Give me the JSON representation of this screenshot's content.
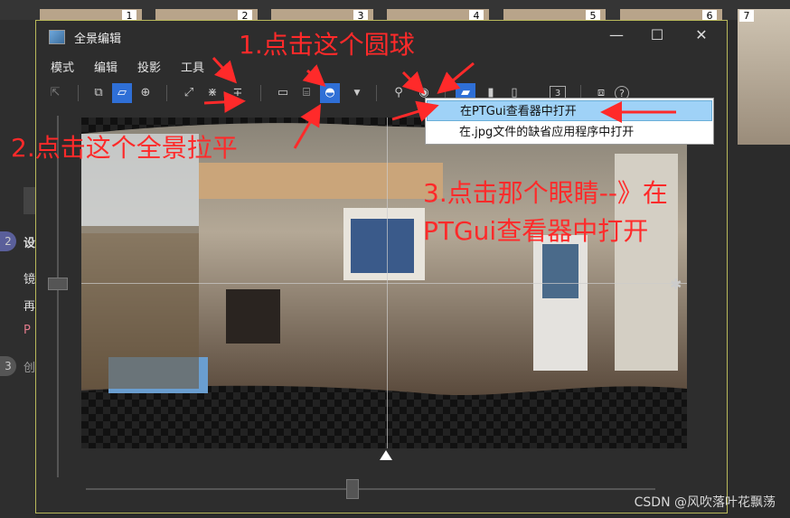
{
  "thumbnails": [
    "1",
    "2",
    "3",
    "4",
    "5",
    "6",
    "7"
  ],
  "sidebar": {
    "step2_num": "2",
    "step2_title": "设",
    "lines": [
      "镜",
      "再",
      "P"
    ],
    "step3_num": "3",
    "step3_title": "创"
  },
  "window": {
    "title": "全景编辑",
    "minimize": "—",
    "maximize": "☐",
    "close": "✕"
  },
  "menubar": [
    "模式",
    "编辑",
    "投影",
    "工具"
  ],
  "toolbar": {
    "number_badge": "3",
    "help": "?"
  },
  "dropdown": {
    "items": [
      "在PTGui查看器中打开",
      "在.jpg文件的缺省应用程序中打开"
    ],
    "selected_index": 0
  },
  "annotations": {
    "step1": "1.点击这个圆球",
    "step2": "2.点击这个全景拉平",
    "step3_line1": "3.点击那个眼睛--》在",
    "step3_line2": "PTGui查看器中打开"
  },
  "colors": {
    "annotation": "#ff2a2a",
    "active_tool": "#2f6fd6",
    "menu_highlight": "#9fd2f7",
    "window_border": "#b9b95a"
  },
  "watermark": "CSDN @风吹落叶花飘荡"
}
